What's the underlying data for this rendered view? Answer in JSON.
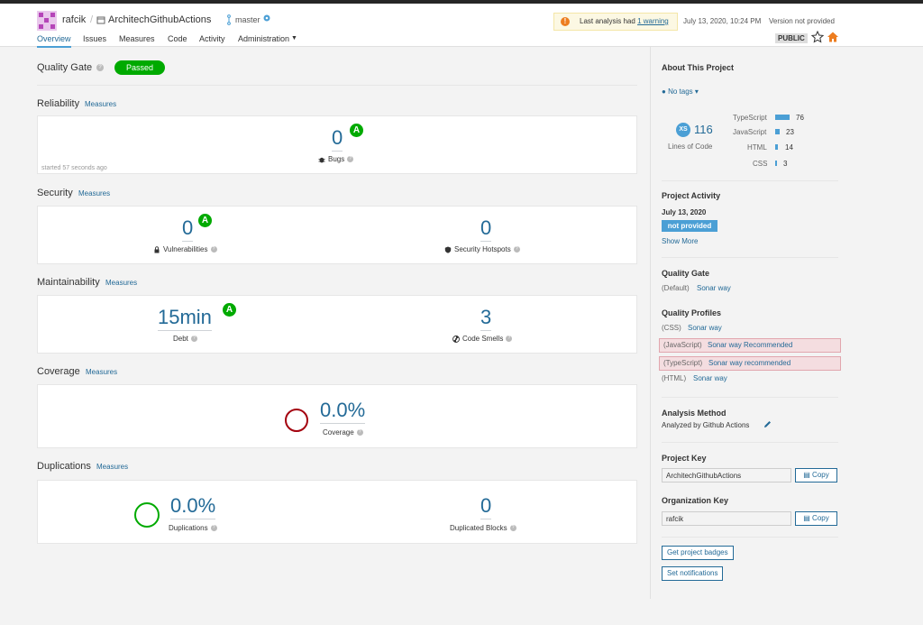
{
  "header": {
    "organization": "rafcik",
    "separator": "/",
    "project": "ArchitechGithubActions",
    "branch": "master",
    "nav": [
      "Overview",
      "Issues",
      "Measures",
      "Code",
      "Activity",
      "Administration"
    ],
    "warning": {
      "prefix": "Last analysis had",
      "link": "1 warning"
    },
    "timestamp": "July 13, 2020, 10:24 PM",
    "version": "Version not provided",
    "visibility": "PUBLIC"
  },
  "quality_gate": {
    "title": "Quality Gate",
    "status": "Passed"
  },
  "measures_label": "Measures",
  "reliability": {
    "title": "Reliability",
    "bugs": "0",
    "bugs_rating": "A",
    "bugs_label": "Bugs",
    "started": "started 57 seconds ago"
  },
  "security": {
    "title": "Security",
    "vulnerabilities": "0",
    "vuln_rating": "A",
    "vuln_label": "Vulnerabilities",
    "hotspots": "0",
    "hotspots_label": "Security Hotspots"
  },
  "maintainability": {
    "title": "Maintainability",
    "debt": "15min",
    "debt_rating": "A",
    "debt_label": "Debt",
    "smells": "3",
    "smells_label": "Code Smells"
  },
  "coverage": {
    "title": "Coverage",
    "value": "0.0%",
    "label": "Coverage"
  },
  "duplications": {
    "title": "Duplications",
    "value": "0.0%",
    "label": "Duplications",
    "blocks": "0",
    "blocks_label": "Duplicated Blocks"
  },
  "sidebar": {
    "about_title": "About This Project",
    "tags": "No tags",
    "size_badge": "XS",
    "lines": "116",
    "lines_label": "Lines of Code",
    "languages": [
      {
        "name": "TypeScript",
        "count": "76",
        "value": 76
      },
      {
        "name": "JavaScript",
        "count": "23",
        "value": 23
      },
      {
        "name": "HTML",
        "count": "14",
        "value": 14
      },
      {
        "name": "CSS",
        "count": "3",
        "value": 3
      }
    ],
    "activity_title": "Project Activity",
    "activity_date": "July 13, 2020",
    "activity_badge": "not provided",
    "show_more": "Show More",
    "qg_title": "Quality Gate",
    "qg_default": "(Default)",
    "qg_name": "Sonar way",
    "qp_title": "Quality Profiles",
    "profiles": [
      {
        "lang": "(CSS)",
        "name": "Sonar way"
      },
      {
        "lang": "(JavaScript)",
        "name": "Sonar way Recommended"
      },
      {
        "lang": "(TypeScript)",
        "name": "Sonar way recommended"
      },
      {
        "lang": "(HTML)",
        "name": "Sonar way"
      }
    ],
    "analysis_title": "Analysis Method",
    "analysis_text": "Analyzed by Github Actions",
    "project_key_title": "Project Key",
    "project_key": "ArchitechGithubActions",
    "org_key_title": "Organization Key",
    "org_key": "rafcik",
    "copy": "Copy",
    "badges_btn": "Get project badges",
    "notif_btn": "Set notifications"
  },
  "colors": {
    "accent": "#236a97",
    "passed": "#00aa00",
    "coverage_ring": "#a4030f",
    "dup_ring": "#00aa00"
  }
}
